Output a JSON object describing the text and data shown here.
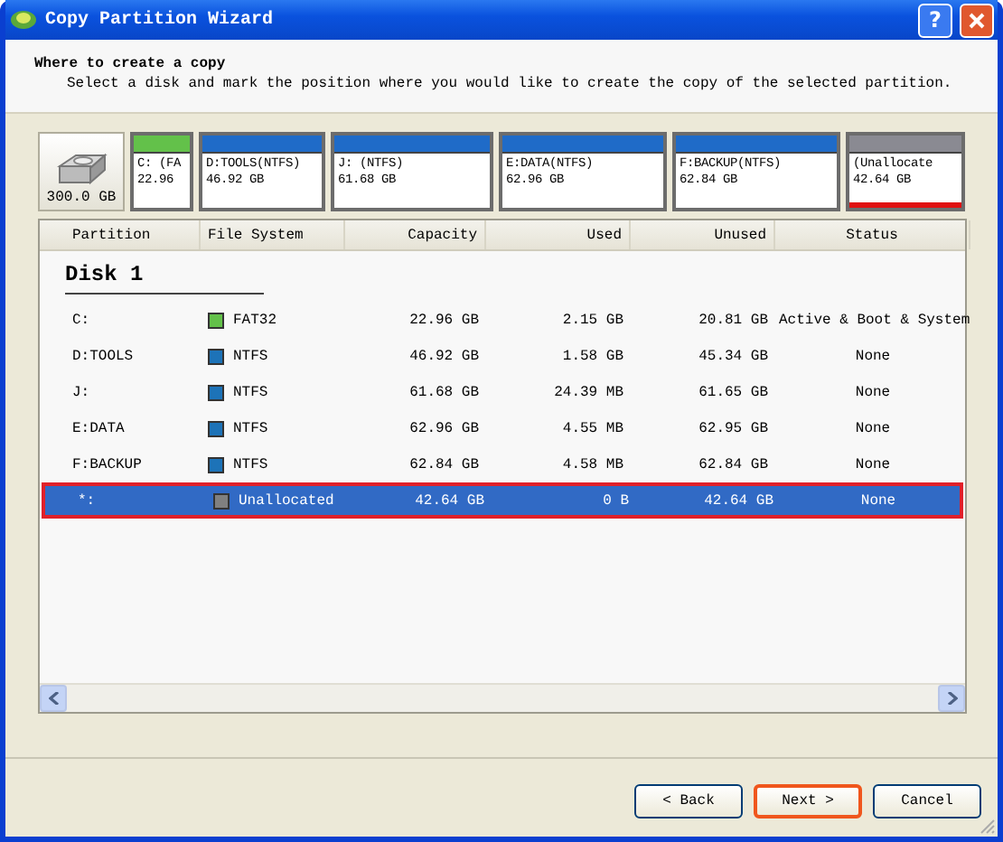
{
  "window": {
    "title": "Copy Partition Wizard",
    "help": "?"
  },
  "header": {
    "heading": "Where to create a copy",
    "description": "Select a disk and mark the position where you would like to create the copy of the selected partition."
  },
  "disk_map": {
    "disk_size": "300.0 GB",
    "partitions": [
      {
        "label": "C: (FA",
        "size": "22.96",
        "color": "#63c14a",
        "selected": false
      },
      {
        "label": "D:TOOLS(NTFS)",
        "size": "46.92 GB",
        "color": "#1f6bc8",
        "selected": false
      },
      {
        "label": "J: (NTFS)",
        "size": "61.68 GB",
        "color": "#1f6bc8",
        "selected": false
      },
      {
        "label": "E:DATA(NTFS)",
        "size": "62.96 GB",
        "color": "#1f6bc8",
        "selected": false
      },
      {
        "label": "F:BACKUP(NTFS)",
        "size": "62.84 GB",
        "color": "#1f6bc8",
        "selected": false
      },
      {
        "label": "(Unallocate",
        "size": "42.64 GB",
        "color": "#8a8a92",
        "selected": true
      }
    ]
  },
  "table": {
    "columns": [
      "Partition",
      "File System",
      "Capacity",
      "Used",
      "Unused",
      "Status"
    ],
    "group": "Disk 1",
    "rows": [
      {
        "partition": "C:",
        "file_system": "FAT32",
        "color": "#63c14a",
        "capacity": "22.96 GB",
        "used": "2.15 GB",
        "unused": "20.81 GB",
        "status": "Active & Boot & System",
        "selected": false
      },
      {
        "partition": "D:TOOLS",
        "file_system": "NTFS",
        "color": "#1d73b8",
        "capacity": "46.92 GB",
        "used": "1.58 GB",
        "unused": "45.34 GB",
        "status": "None",
        "selected": false
      },
      {
        "partition": "J:",
        "file_system": "NTFS",
        "color": "#1d73b8",
        "capacity": "61.68 GB",
        "used": "24.39 MB",
        "unused": "61.65 GB",
        "status": "None",
        "selected": false
      },
      {
        "partition": "E:DATA",
        "file_system": "NTFS",
        "color": "#1d73b8",
        "capacity": "62.96 GB",
        "used": "4.55 MB",
        "unused": "62.95 GB",
        "status": "None",
        "selected": false
      },
      {
        "partition": "F:BACKUP",
        "file_system": "NTFS",
        "color": "#1d73b8",
        "capacity": "62.84 GB",
        "used": "4.58 MB",
        "unused": "62.84 GB",
        "status": "None",
        "selected": false
      },
      {
        "partition": "*:",
        "file_system": "Unallocated",
        "color": "#808080",
        "capacity": "42.64 GB",
        "used": "0 B",
        "unused": "42.64 GB",
        "status": "None",
        "selected": true
      }
    ]
  },
  "buttons": [
    {
      "label": "< Back",
      "focused": false
    },
    {
      "label": "Next >",
      "focused": true
    },
    {
      "label": "Cancel",
      "focused": false
    }
  ]
}
